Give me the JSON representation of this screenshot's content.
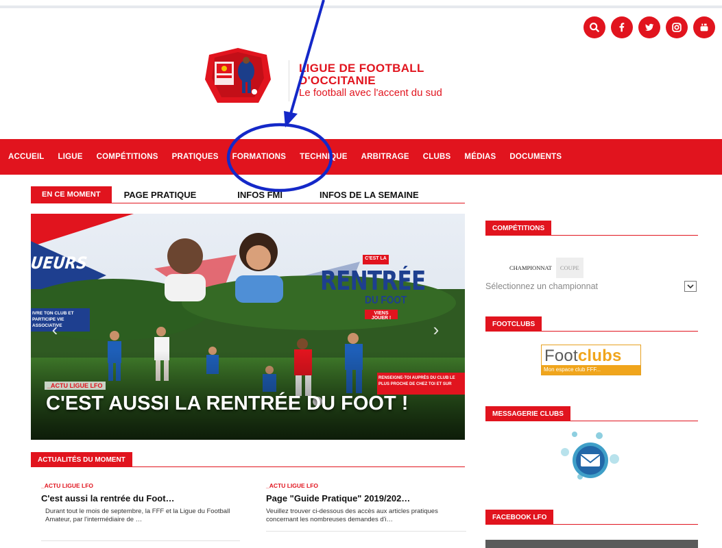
{
  "social": [
    {
      "icon": "search-icon"
    },
    {
      "icon": "facebook-icon"
    },
    {
      "icon": "twitter-icon"
    },
    {
      "icon": "instagram-icon"
    },
    {
      "icon": "youtube-icon"
    }
  ],
  "brand": {
    "title": "LIGUE DE FOOTBALL D'OCCITANIE",
    "subtitle": "Le football avec l'accent du sud",
    "logo_text_top": "Occitanie",
    "logo_text_bottom": "Ligue de Football"
  },
  "nav": {
    "items": [
      "ACCUEIL",
      "LIGUE",
      "COMPÉTITIONS",
      "PRATIQUES",
      "FORMATIONS",
      "TECHNIQUE",
      "ARBITRAGE",
      "CLUBS",
      "MÉDIAS",
      "DOCUMENTS"
    ]
  },
  "tabs": {
    "active": "EN CE MOMENT",
    "items": [
      "PAGE PRATIQUE",
      "INFOS FMI",
      "INFOS DE LA SEMAINE"
    ]
  },
  "hero": {
    "category": "_ACTU LIGUE LFO",
    "title": "C'EST AUSSI LA RENTRÉE DU FOOT !",
    "side_text_left": "UEURS",
    "banner_small_left": "IVRE TON CLUB ET PARTICIPE VIE ASSOCIATIVE",
    "badge_top": "C'EST LA",
    "badge_main": "RENTRÉE",
    "badge_sub": "DU FOOT",
    "badge_cta": "VIENS JOUER !",
    "banner_small_right": "RENSEIGNE-TOI AUPRÈS DU CLUB LE PLUS PROCHE DE CHEZ TOI ET SUR"
  },
  "actualites": {
    "header": "ACTUALITÉS DU MOMENT",
    "items": [
      {
        "category": "_ACTU LIGUE LFO",
        "title": "C'est aussi la rentrée du Foot…",
        "text": "Durant tout le mois de septembre, la FFF et la Ligue du Football Amateur, par l'intermédiaire de …"
      },
      {
        "category": "_ACTU LIGUE LFO",
        "title": "Page \"Guide Pratique\" 2019/202…",
        "text": "Veuillez trouver ci-dessous des accès aux articles pratiques concernant les nombreuses demandes d'i…"
      }
    ]
  },
  "sidebar": {
    "competitions": {
      "header": "COMPÉTITIONS",
      "tab_active": "CHAMPIONNAT",
      "tab_inactive": "COUPE",
      "select_value": "Sélectionnez un championnat"
    },
    "footclubs": {
      "header": "FOOTCLUBS",
      "logo_part1": "Foot",
      "logo_part2": "clubs",
      "tagline": "Mon espace club FFF..."
    },
    "messagerie": {
      "header": "MESSAGERIE CLUBS"
    },
    "facebook": {
      "header": "FACEBOOK LFO"
    }
  },
  "colors": {
    "brand_red": "#e1141e",
    "annotation_blue": "#1428c8"
  }
}
